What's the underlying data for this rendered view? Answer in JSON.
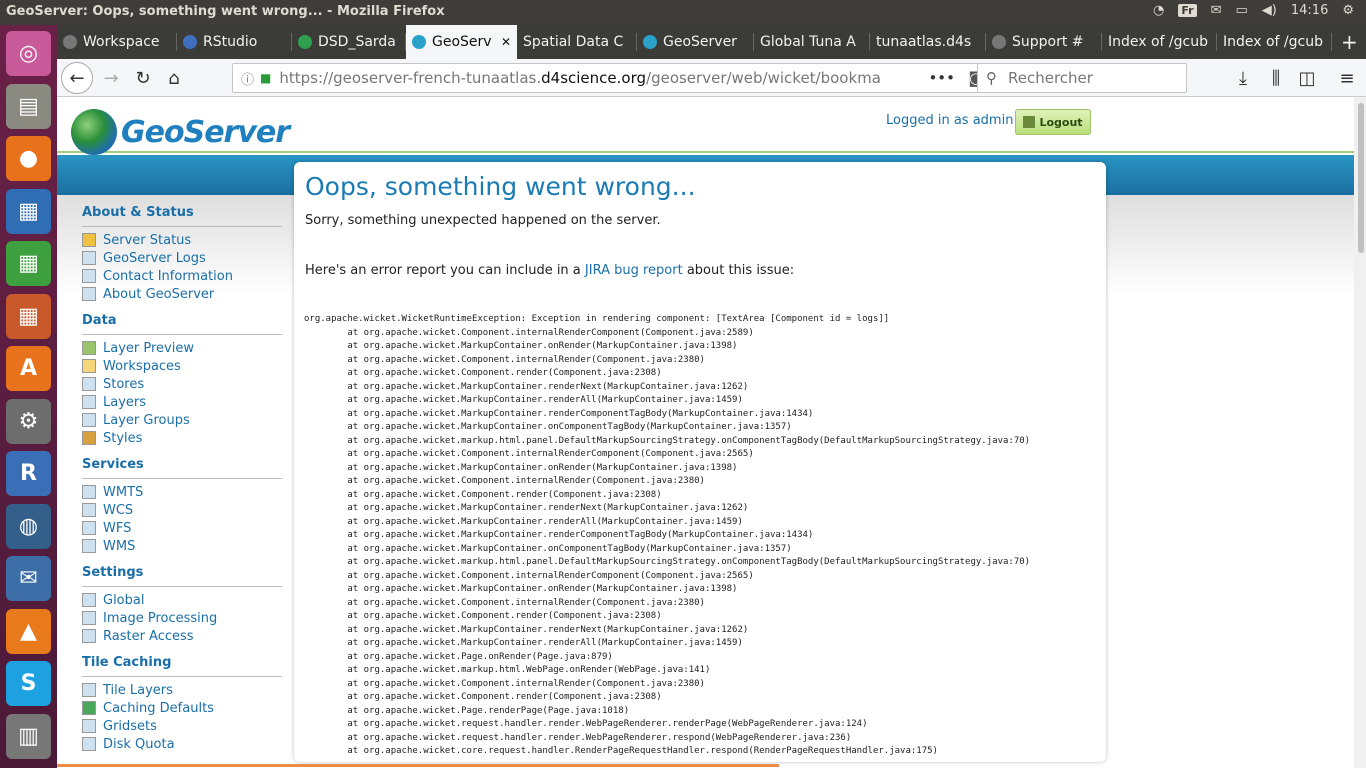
{
  "topbar": {
    "title": "GeoServer: Oops, something went wrong... - Mozilla Firefox",
    "keyboard": "Fr",
    "time": "14:16"
  },
  "tabs": [
    {
      "label": "Workspace",
      "color": "#777777"
    },
    {
      "label": "RStudio",
      "color": "#3f6fbf"
    },
    {
      "label": "DSD_Sarda",
      "color": "#2e9e4f"
    },
    {
      "label": "GeoServ",
      "color": "#2aa1c9"
    },
    {
      "label": "Spatial Data C",
      "color": ""
    },
    {
      "label": "GeoServer",
      "color": "#2aa1c9"
    },
    {
      "label": "Global Tuna A",
      "color": ""
    },
    {
      "label": "tunaatlas.d4s",
      "color": ""
    },
    {
      "label": "Support #",
      "color": "#777777"
    },
    {
      "label": "Index of /gcub",
      "color": ""
    },
    {
      "label": "Index of /gcub",
      "color": ""
    }
  ],
  "nav": {
    "url_prefix": "https://geoserver-french-tunaatlas.",
    "url_domain": "d4science.org",
    "url_suffix": "/geoserver/web/wicket/bookma",
    "search_placeholder": "Rechercher"
  },
  "header": {
    "logo_text": "GeoServer",
    "logged_in": "Logged in as admin.",
    "logout": "Logout"
  },
  "sidebar": [
    {
      "title": "About & Status",
      "items": [
        {
          "label": "Server Status",
          "icon": "warning-icon"
        },
        {
          "label": "GeoServer Logs",
          "icon": "document-icon"
        },
        {
          "label": "Contact Information",
          "icon": "contact-icon"
        },
        {
          "label": "About GeoServer",
          "icon": "info-icon"
        }
      ]
    },
    {
      "title": "Data",
      "items": [
        {
          "label": "Layer Preview",
          "icon": "map-icon"
        },
        {
          "label": "Workspaces",
          "icon": "folder-icon"
        },
        {
          "label": "Stores",
          "icon": "database-icon"
        },
        {
          "label": "Layers",
          "icon": "layers-icon"
        },
        {
          "label": "Layer Groups",
          "icon": "layer-groups-icon"
        },
        {
          "label": "Styles",
          "icon": "palette-icon"
        }
      ]
    },
    {
      "title": "Services",
      "items": [
        {
          "label": "WMTS",
          "icon": "service-icon"
        },
        {
          "label": "WCS",
          "icon": "service-icon"
        },
        {
          "label": "WFS",
          "icon": "service-icon"
        },
        {
          "label": "WMS",
          "icon": "service-icon"
        }
      ]
    },
    {
      "title": "Settings",
      "items": [
        {
          "label": "Global",
          "icon": "server-icon"
        },
        {
          "label": "Image Processing",
          "icon": "image-icon"
        },
        {
          "label": "Raster Access",
          "icon": "raster-icon"
        }
      ]
    },
    {
      "title": "Tile Caching",
      "items": [
        {
          "label": "Tile Layers",
          "icon": "grid-icon"
        },
        {
          "label": "Caching Defaults",
          "icon": "globe-icon"
        },
        {
          "label": "Gridsets",
          "icon": "grid-icon"
        },
        {
          "label": "Disk Quota",
          "icon": "disk-icon"
        }
      ]
    }
  ],
  "error": {
    "title": "Oops, something went wrong...",
    "message": "Sorry, something unexpected happened on the server.",
    "report_prefix": "Here's an error report you can include in a ",
    "report_link": "JIRA bug report",
    "report_suffix": " about this issue:",
    "trace": "org.apache.wicket.WicketRuntimeException: Exception in rendering component: [TextArea [Component id = logs]]\n\tat org.apache.wicket.Component.internalRenderComponent(Component.java:2589)\n\tat org.apache.wicket.MarkupContainer.onRender(MarkupContainer.java:1398)\n\tat org.apache.wicket.Component.internalRender(Component.java:2380)\n\tat org.apache.wicket.Component.render(Component.java:2308)\n\tat org.apache.wicket.MarkupContainer.renderNext(MarkupContainer.java:1262)\n\tat org.apache.wicket.MarkupContainer.renderAll(MarkupContainer.java:1459)\n\tat org.apache.wicket.MarkupContainer.renderComponentTagBody(MarkupContainer.java:1434)\n\tat org.apache.wicket.MarkupContainer.onComponentTagBody(MarkupContainer.java:1357)\n\tat org.apache.wicket.markup.html.panel.DefaultMarkupSourcingStrategy.onComponentTagBody(DefaultMarkupSourcingStrategy.java:70)\n\tat org.apache.wicket.Component.internalRenderComponent(Component.java:2565)\n\tat org.apache.wicket.MarkupContainer.onRender(MarkupContainer.java:1398)\n\tat org.apache.wicket.Component.internalRender(Component.java:2380)\n\tat org.apache.wicket.Component.render(Component.java:2308)\n\tat org.apache.wicket.MarkupContainer.renderNext(MarkupContainer.java:1262)\n\tat org.apache.wicket.MarkupContainer.renderAll(MarkupContainer.java:1459)\n\tat org.apache.wicket.MarkupContainer.renderComponentTagBody(MarkupContainer.java:1434)\n\tat org.apache.wicket.MarkupContainer.onComponentTagBody(MarkupContainer.java:1357)\n\tat org.apache.wicket.markup.html.panel.DefaultMarkupSourcingStrategy.onComponentTagBody(DefaultMarkupSourcingStrategy.java:70)\n\tat org.apache.wicket.Component.internalRenderComponent(Component.java:2565)\n\tat org.apache.wicket.MarkupContainer.onRender(MarkupContainer.java:1398)\n\tat org.apache.wicket.Component.internalRender(Component.java:2380)\n\tat org.apache.wicket.Component.render(Component.java:2308)\n\tat org.apache.wicket.MarkupContainer.renderNext(MarkupContainer.java:1262)\n\tat org.apache.wicket.MarkupContainer.renderAll(MarkupContainer.java:1459)\n\tat org.apache.wicket.Page.onRender(Page.java:879)\n\tat org.apache.wicket.markup.html.WebPage.onRender(WebPage.java:141)\n\tat org.apache.wicket.Component.internalRender(Component.java:2380)\n\tat org.apache.wicket.Component.render(Component.java:2308)\n\tat org.apache.wicket.Page.renderPage(Page.java:1018)\n\tat org.apache.wicket.request.handler.render.WebPageRenderer.renderPage(WebPageRenderer.java:124)\n\tat org.apache.wicket.request.handler.render.WebPageRenderer.respond(WebPageRenderer.java:236)\n\tat org.apache.wicket.core.request.handler.RenderPageRequestHandler.respond(RenderPageRequestHandler.java:175)"
  },
  "launcher": [
    {
      "name": "ubuntu-dash-icon",
      "color": "#c95a9a",
      "glyph": "◎"
    },
    {
      "name": "files-icon",
      "color": "#8a8a80",
      "glyph": "▤"
    },
    {
      "name": "firefox-icon",
      "color": "#e8721c",
      "glyph": "●"
    },
    {
      "name": "writer-icon",
      "color": "#2f6db5",
      "glyph": "▦"
    },
    {
      "name": "calc-icon",
      "color": "#3e9f3e",
      "glyph": "▦"
    },
    {
      "name": "impress-icon",
      "color": "#c9582b",
      "glyph": "▦"
    },
    {
      "name": "software-center-icon",
      "color": "#e8731c",
      "glyph": "A"
    },
    {
      "name": "system-settings-icon",
      "color": "#6d6d6d",
      "glyph": "⚙"
    },
    {
      "name": "rstudio-icon",
      "color": "#3a6fb8",
      "glyph": "R"
    },
    {
      "name": "pgadmin-icon",
      "color": "#335f8a",
      "glyph": "◍"
    },
    {
      "name": "thunderbird-icon",
      "color": "#3d6ea8",
      "glyph": "✉"
    },
    {
      "name": "vlc-icon",
      "color": "#e87a1c",
      "glyph": "▲"
    },
    {
      "name": "skype-icon",
      "color": "#1ea1e1",
      "glyph": "S"
    },
    {
      "name": "trash-icon",
      "color": "#777777",
      "glyph": "▥"
    }
  ]
}
